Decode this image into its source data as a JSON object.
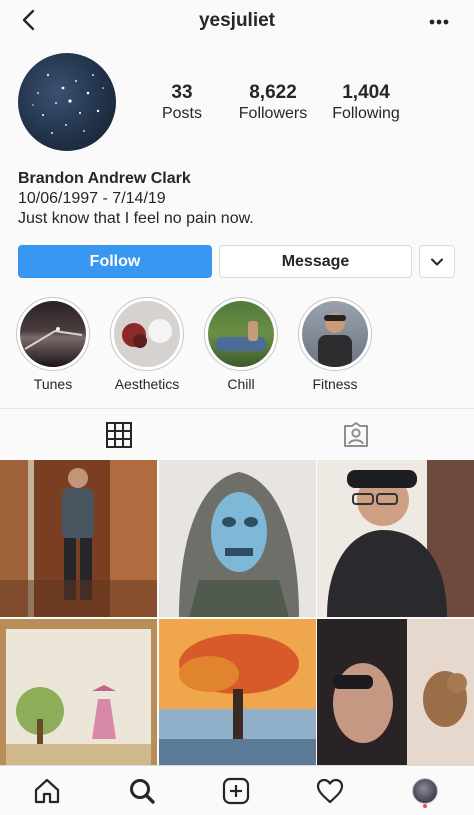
{
  "header": {
    "username": "yesjuliet",
    "back_icon": "chevron-left-icon",
    "more_icon": "more-dots-icon"
  },
  "profile": {
    "stats": [
      {
        "value": "33",
        "label": "Posts"
      },
      {
        "value": "8,622",
        "label": "Followers"
      },
      {
        "value": "1,404",
        "label": "Following"
      }
    ],
    "name": "Brandon Andrew Clark",
    "bio_line1": "10/06/1997 - 7/14/19",
    "bio_line2": "Just know that I feel no pain now."
  },
  "actions": {
    "follow": "Follow",
    "message": "Message",
    "dropdown_icon": "chevron-down-icon"
  },
  "highlights": [
    {
      "label": "Tunes"
    },
    {
      "label": "Aesthetics"
    },
    {
      "label": "Chill"
    },
    {
      "label": "Fitness"
    }
  ],
  "tabs": {
    "grid_icon": "grid-icon",
    "tagged_icon": "tagged-person-icon"
  },
  "colors": {
    "accent": "#3897f0",
    "notification": "#ed4956"
  },
  "nav": [
    "home-icon",
    "search-icon",
    "add-post-icon",
    "heart-icon",
    "profile-avatar"
  ]
}
